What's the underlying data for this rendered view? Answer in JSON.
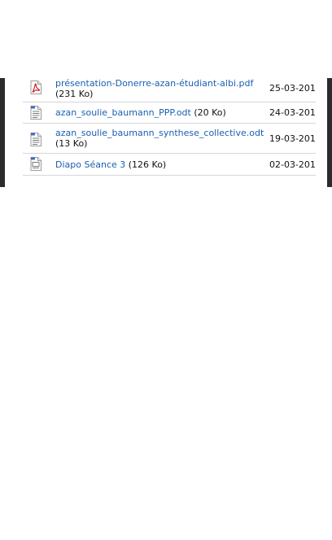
{
  "files": [
    {
      "name": "présentation-Donerre-azan-étudiant-albi.pdf",
      "size": "(231 Ko)",
      "date": "25-03-201",
      "icon": "pdf-file-icon",
      "accent": "#cc1a1a"
    },
    {
      "name": "azan_soulie_baumann_PPP.odt",
      "size": "(20 Ko)",
      "date": "24-03-201",
      "icon": "document-file-icon",
      "accent": "#3a6fc4"
    },
    {
      "name": "azan_soulie_baumann_synthese_collective.odt",
      "size": "(13 Ko)",
      "date": "19-03-201",
      "icon": "document-file-icon",
      "accent": "#3a6fc4"
    },
    {
      "name": "Diapo Séance 3",
      "size": "(126 Ko)",
      "date": "02-03-201",
      "icon": "presentation-file-icon",
      "accent": "#3a6fc4"
    }
  ],
  "colors": {
    "link": "#1a5fb0",
    "divider": "#d6d6d6",
    "frame_edge": "#2b2b2b"
  }
}
